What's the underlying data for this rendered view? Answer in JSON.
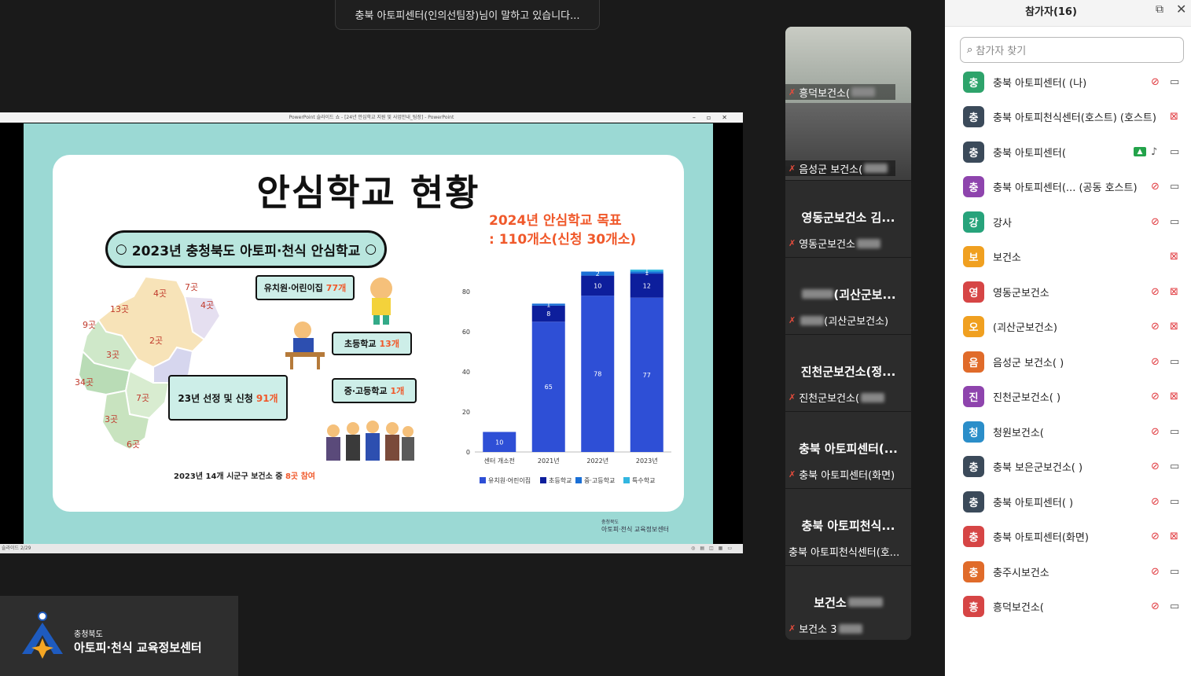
{
  "speaker_banner": "충북 아토피센터(인의선팀장)님이 말하고 있습니다...",
  "share": {
    "window_title": "PowerPoint 슬라이드 쇼 - [24년 안심학교 지원 및 사업안내_팀장] - PowerPoint",
    "status_text": "슬라이드 2/29",
    "slide": {
      "title": "안심학교 현황",
      "goal_line1": "2024년 안심학교 목표",
      "goal_line2": ": 110개소(신청 30개소)",
      "pill": "2023년 충청북도 아토피·천식 안심학교",
      "bubble_kinder_label": "유치원·어린이집",
      "bubble_kinder_count": "77개",
      "bubble_elem_label": "초등학교",
      "bubble_elem_count": "13개",
      "bubble_mid_label": "중·고등학교",
      "bubble_mid_count": "1개",
      "bubble_total_label": "23년 선정 및 신청",
      "bubble_total_count": "91개",
      "footnote": "2023년 14개 시군구 보건소 중",
      "footnote_red": "8곳 참여",
      "map_labels": [
        "4곳",
        "7곳",
        "13곳",
        "4곳",
        "9곳",
        "2곳",
        "3곳",
        "34곳",
        "7곳",
        "3곳",
        "6곳"
      ],
      "logo_small": "충청북도",
      "logo_name": "아토피·천식 교육정보센터"
    }
  },
  "chart_data": {
    "type": "bar",
    "stacked": true,
    "categories": [
      "센터 개소전",
      "2021년",
      "2022년",
      "2023년"
    ],
    "series": [
      {
        "name": "유치원·어린이집",
        "values": [
          10,
          65,
          78,
          77
        ],
        "color": "#2e4fd6"
      },
      {
        "name": "초등학교",
        "values": [
          0,
          8,
          10,
          12
        ],
        "color": "#0d1e9c"
      },
      {
        "name": "중·고등학교",
        "values": [
          0,
          1,
          2,
          1
        ],
        "color": "#1a6fd6"
      },
      {
        "name": "특수학교",
        "values": [
          0,
          0,
          0,
          1
        ],
        "color": "#32b6e0"
      }
    ],
    "ylim": [
      0,
      100
    ],
    "yticks": [
      0,
      20,
      40,
      60,
      80,
      100
    ],
    "legend_position": "bottom"
  },
  "tiles": [
    {
      "kind": "video",
      "caption": "흥덕보건소("
    },
    {
      "kind": "video",
      "caption": "음성군 보건소("
    },
    {
      "kind": "name",
      "big": "영동군보건소 김...",
      "small": "영동군보건소"
    },
    {
      "kind": "name",
      "big": "(괴산군보...",
      "small": "(괴산군보건소)"
    },
    {
      "kind": "name",
      "big": "진천군보건소(정...",
      "small": "진천군보건소("
    },
    {
      "kind": "name",
      "big": "충북 아토피센터(...",
      "small": "충북 아토피센터(화면)"
    },
    {
      "kind": "name",
      "big": "충북 아토피천식...",
      "small": "충북 아토피천식센터(호..."
    },
    {
      "kind": "name",
      "big": "보건소",
      "small": "보건소 3"
    }
  ],
  "corner_logo": {
    "small": "충청북도",
    "name": "아토피·천식 교육정보센터"
  },
  "panel": {
    "title": "참가자(16)",
    "search_placeholder": "참가자 찾기",
    "participants": [
      {
        "avatar": "충",
        "color": "#2ea36b",
        "name": "충북 아토피센터(      (나)",
        "mic": "muted",
        "cam": "on"
      },
      {
        "avatar": "충",
        "color": "#3b4a5a",
        "name": "충북 아토피천식센터(호스트) (호스트)",
        "mic": "none",
        "cam": "off"
      },
      {
        "avatar": "충",
        "color": "#3b4a5a",
        "name": "충북 아토피센터(",
        "mic": "on",
        "cam": "on",
        "sharing": true
      },
      {
        "avatar": "충",
        "color": "#8e44ad",
        "name": "충북 아토피센터(...   (공동 호스트)",
        "mic": "muted",
        "cam": "on"
      },
      {
        "avatar": "강",
        "color": "#27a37b",
        "name": "강사",
        "mic": "muted",
        "cam": "on"
      },
      {
        "avatar": "보",
        "color": "#f0a020",
        "name": "보건소",
        "mic": "none",
        "cam": "muted"
      },
      {
        "avatar": "영",
        "color": "#d64545",
        "name": "영동군보건소",
        "mic": "muted",
        "cam": "off"
      },
      {
        "avatar": "오",
        "color": "#f0a020",
        "name": "(괴산군보건소)",
        "mic": "muted",
        "cam": "off"
      },
      {
        "avatar": "음",
        "color": "#e06b2a",
        "name": "음성군 보건소(      )",
        "mic": "muted",
        "cam": "on"
      },
      {
        "avatar": "진",
        "color": "#8e44ad",
        "name": "진천군보건소(      )",
        "mic": "muted",
        "cam": "off"
      },
      {
        "avatar": "청",
        "color": "#2b8ec9",
        "name": "청원보건소(",
        "mic": "muted",
        "cam": "on"
      },
      {
        "avatar": "충",
        "color": "#3b4a5a",
        "name": "충북 보은군보건소(      )",
        "mic": "muted",
        "cam": "on"
      },
      {
        "avatar": "충",
        "color": "#3b4a5a",
        "name": "충북 아토피센터(      )",
        "mic": "muted",
        "cam": "on"
      },
      {
        "avatar": "충",
        "color": "#d64545",
        "name": "충북 아토피센터(화면)",
        "mic": "muted",
        "cam": "off"
      },
      {
        "avatar": "충",
        "color": "#e06b2a",
        "name": "충주시보건소",
        "mic": "muted",
        "cam": "on"
      },
      {
        "avatar": "흥",
        "color": "#d64545",
        "name": "흥덕보건소(",
        "mic": "muted",
        "cam": "on"
      }
    ]
  }
}
